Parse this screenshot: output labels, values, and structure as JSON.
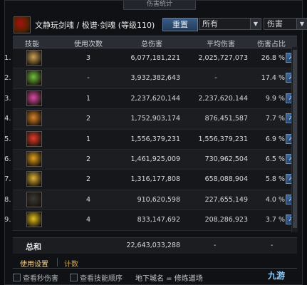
{
  "window": {
    "title": "伤害统计",
    "character_name": "文静玩剑魂 / 极谱·剑魂 (等级110)",
    "reset_label": "重置",
    "filter_all": "所有",
    "filter_damage": "伤害"
  },
  "columns": {
    "skill": "技能",
    "uses": "使用次数",
    "total": "总伤害",
    "avg": "平均伤害",
    "pct": "伤害占比"
  },
  "rows": [
    {
      "rank": "1.",
      "uses": "3",
      "total": "6,077,181,221",
      "avg": "2,025,727,073",
      "pct": "26.8 %",
      "icon_color": "#c9a15a"
    },
    {
      "rank": "2.",
      "uses": "-",
      "total": "3,932,382,643",
      "avg": "-",
      "pct": "17.4 %",
      "icon_color": "#6fbf3e"
    },
    {
      "rank": "3.",
      "uses": "1",
      "total": "2,237,620,144",
      "avg": "2,237,620,144",
      "pct": "9.9 %",
      "icon_color": "#d94aa8"
    },
    {
      "rank": "4.",
      "uses": "2",
      "total": "1,752,903,174",
      "avg": "876,451,587",
      "pct": "7.7 %",
      "icon_color": "#d9822b"
    },
    {
      "rank": "5.",
      "uses": "1",
      "total": "1,556,379,231",
      "avg": "1,556,379,231",
      "pct": "6.9 %",
      "icon_color": "#e63b2b"
    },
    {
      "rank": "6.",
      "uses": "2",
      "total": "1,461,925,009",
      "avg": "730,962,504",
      "pct": "6.5 %",
      "icon_color": "#e0a21f"
    },
    {
      "rank": "7.",
      "uses": "2",
      "total": "1,316,177,808",
      "avg": "658,088,904",
      "pct": "5.8 %",
      "icon_color": "#d9b23a"
    },
    {
      "rank": "8.",
      "uses": "4",
      "total": "910,620,598",
      "avg": "227,655,149",
      "pct": "4.0 %",
      "icon_color": "#3a3a3a"
    },
    {
      "rank": "9.",
      "uses": "4",
      "total": "833,147,692",
      "avg": "208,286,923",
      "pct": "3.7 %",
      "icon_color": "#e0c020"
    }
  ],
  "totals": {
    "label": "总和",
    "total": "22,643,033,288",
    "avg": "-",
    "pct": "-"
  },
  "tabs": {
    "settings": "使用设置",
    "count": "计数"
  },
  "footer": {
    "check_dps": "查看秒伤害",
    "check_order": "查看技能顺序",
    "location": "地下城名 = 修炼道场"
  },
  "watermark": "九游"
}
